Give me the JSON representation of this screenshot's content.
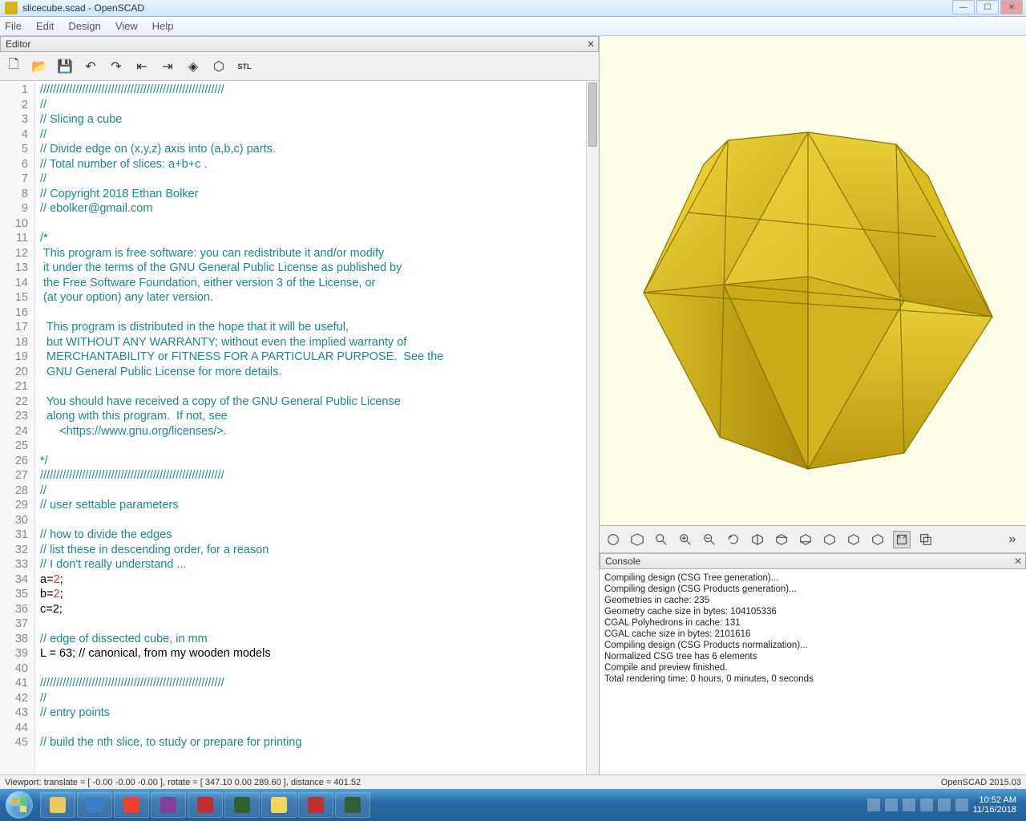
{
  "window": {
    "title": "slicecube.scad - OpenSCAD"
  },
  "menu": {
    "file": "File",
    "edit": "Edit",
    "design": "Design",
    "view": "View",
    "help": "Help"
  },
  "editor": {
    "title": "Editor",
    "lines": [
      "/////////////////////////////////////////////////////////",
      "//",
      "// Slicing a cube",
      "//",
      "// Divide edge on (x,y,z) axis into (a,b,c) parts.",
      "// Total number of slices: a+b+c .",
      "//",
      "// Copyright 2018 Ethan Bolker",
      "// ebolker@gmail.com",
      "",
      "/*",
      " This program is free software: you can redistribute it and/or modify",
      " it under the terms of the GNU General Public License as published by",
      " the Free Software Foundation, either version 3 of the License, or",
      " (at your option) any later version.",
      "",
      "  This program is distributed in the hope that it will be useful,",
      "  but WITHOUT ANY WARRANTY; without even the implied warranty of",
      "  MERCHANTABILITY or FITNESS FOR A PARTICULAR PURPOSE.  See the",
      "  GNU General Public License for more details.",
      "",
      "  You should have received a copy of the GNU General Public License",
      "  along with this program.  If not, see\n      <https://www.gnu.org/licenses/>.",
      "",
      "*/",
      "/////////////////////////////////////////////////////////",
      "//",
      "// user settable parameters",
      "",
      "// how to divide the edges",
      "// list these in descending order, for a reason",
      "// I don't really understand ...",
      "a=2;",
      "b=2;",
      "c=2;",
      "",
      "// edge of dissected cube, in mm",
      "L = 63; // canonical, from my wooden models",
      "",
      "/////////////////////////////////////////////////////////",
      "//",
      "// entry points",
      "",
      "// build the nth slice, to study or prepare for printing"
    ]
  },
  "console": {
    "title": "Console",
    "lines": [
      "Compiling design (CSG Tree generation)...",
      "Compiling design (CSG Products generation)...",
      "Geometries in cache: 235",
      "Geometry cache size in bytes: 104105336",
      "CGAL Polyhedrons in cache: 131",
      "CGAL cache size in bytes: 2101616",
      "Compiling design (CSG Products normalization)...",
      "Normalized CSG tree has 6 elements",
      "Compile and preview finished.",
      "Total rendering time: 0 hours, 0 minutes, 0 seconds"
    ]
  },
  "status": {
    "left": "Viewport: translate = [ -0.00 -0.00 -0.00 ], rotate = [ 347.10 0.00 289.60 ], distance = 401.52",
    "right": "OpenSCAD 2015.03"
  },
  "tray": {
    "time": "10:52 AM",
    "date": "11/16/2018"
  },
  "taskbar_colors": [
    "#f0c860",
    "#3a80c8",
    "#f04030",
    "#8040a0",
    "#c03030",
    "#306030",
    "#f0d860",
    "#c03030",
    "#306030"
  ]
}
